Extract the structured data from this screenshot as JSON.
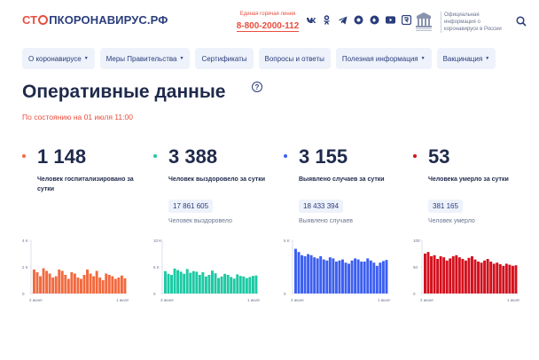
{
  "header": {
    "logo_part1": "СТ",
    "logo_part2": "ПКОРОНАВИРУС.РФ",
    "hotline_label": "Единая горячая линия",
    "hotline_phone": "8-800-2000-112",
    "socials": [
      "vk-icon",
      "ok-icon",
      "telegram-icon",
      "viber-icon",
      "odnoklassniki-icon",
      "youtube-icon",
      "rutube-icon"
    ],
    "gov_text": "Официальная информация о коронавирусе в России"
  },
  "nav": [
    {
      "label": "О коронавирусе",
      "dropdown": true
    },
    {
      "label": "Меры Правительства",
      "dropdown": true
    },
    {
      "label": "Сертификаты",
      "dropdown": false
    },
    {
      "label": "Вопросы и ответы",
      "dropdown": false
    },
    {
      "label": "Полезная информация",
      "dropdown": true
    },
    {
      "label": "Вакцинация",
      "dropdown": true
    }
  ],
  "page": {
    "title": "Оперативные данные",
    "as_of": "По состоянию на 01 июля 11:00"
  },
  "colors": {
    "hospitalized": "#f26a3f",
    "recovered": "#1dc9a4",
    "cases": "#3c5ff0",
    "deaths": "#d3101d"
  },
  "stats": [
    {
      "key": "hospitalized",
      "value": "1 148",
      "desc": "Человек госпитализировано за сутки",
      "total": "",
      "total_label": ""
    },
    {
      "key": "recovered",
      "value": "3 388",
      "desc": "Человек выздоровело за сутки",
      "total": "17 861 605",
      "total_label": "Человек выздоровело"
    },
    {
      "key": "cases",
      "value": "3 155",
      "desc": "Выявлено случаев за сутки",
      "total": "18 433 394",
      "total_label": "Выявлено случаев"
    },
    {
      "key": "deaths",
      "value": "53",
      "desc": "Человека умерло за сутки",
      "total": "381 165",
      "total_label": "Человек умерло"
    }
  ],
  "chart_data": [
    {
      "type": "bar",
      "series_key": "hospitalized",
      "x_start_label": "2 июня",
      "x_end_label": "1 июля",
      "yticks": [
        "4 K",
        "2 K",
        "0"
      ],
      "ylim": [
        0,
        4000
      ],
      "values": [
        1800,
        1600,
        1300,
        1900,
        1700,
        1500,
        1200,
        1300,
        1800,
        1700,
        1400,
        1100,
        1600,
        1500,
        1200,
        1100,
        1400,
        1800,
        1500,
        1300,
        1700,
        1200,
        1000,
        1500,
        1400,
        1300,
        1100,
        1200,
        1350,
        1148
      ]
    },
    {
      "type": "bar",
      "series_key": "recovered",
      "x_start_label": "3 июня",
      "x_end_label": "1 июля",
      "yticks": [
        "10 K",
        "5 K",
        "0"
      ],
      "ylim": [
        0,
        10000
      ],
      "values": [
        4200,
        3700,
        3500,
        4700,
        4400,
        4100,
        3700,
        4600,
        3900,
        4200,
        4100,
        3500,
        4000,
        3200,
        3500,
        4300,
        3800,
        2900,
        3200,
        3700,
        3500,
        3100,
        2800,
        3600,
        3300,
        3200,
        2900,
        3100,
        3300,
        3388
      ]
    },
    {
      "type": "bar",
      "series_key": "cases",
      "x_start_label": "2 июня",
      "x_end_label": "1 июля",
      "yticks": [
        "5 K",
        "0"
      ],
      "ylim": [
        0,
        5000
      ],
      "values": [
        4200,
        3900,
        3600,
        3500,
        3700,
        3600,
        3400,
        3300,
        3500,
        3200,
        3100,
        3400,
        3300,
        3000,
        3100,
        3200,
        2900,
        2800,
        3100,
        3300,
        3200,
        3000,
        3000,
        3300,
        3100,
        2900,
        2600,
        2900,
        3050,
        3155
      ]
    },
    {
      "type": "bar",
      "series_key": "deaths",
      "x_start_label": "2 июня",
      "x_end_label": "1 июля",
      "yticks": [
        "100",
        "50",
        "0"
      ],
      "ylim": [
        0,
        100
      ],
      "values": [
        75,
        78,
        70,
        72,
        65,
        70,
        68,
        62,
        66,
        70,
        72,
        68,
        65,
        62,
        67,
        70,
        64,
        60,
        58,
        62,
        65,
        60,
        56,
        58,
        55,
        52,
        56,
        54,
        52,
        53
      ]
    }
  ]
}
